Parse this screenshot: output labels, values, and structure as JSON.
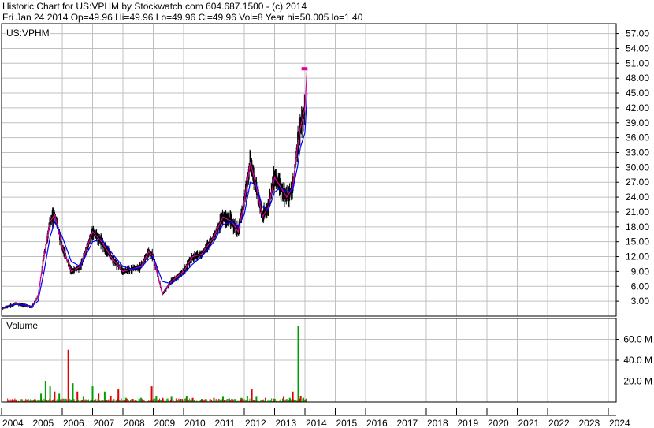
{
  "header": {
    "line1": "Historic Chart for US:VPHM by Stockwatch.com 604.687.1500 - (c) 2014",
    "line2": "Fri Jan 24 2014   Op=49.96  Hi=49.96  Lo=49.96  Cl=49.96  Vol=8   Year hi=50.005  lo=1.40"
  },
  "colors": {
    "grid": "#c0c0c0",
    "price_bar": "#000000",
    "ma_short": "#e000a0",
    "ma_long": "#0000ff",
    "volume_up": "#00a000",
    "volume_down": "#e00000"
  },
  "chart_data": [
    {
      "type": "line",
      "title": "US:VPHM",
      "ylim": [
        0,
        59
      ],
      "y_ticks": [
        "57.00",
        "54.00",
        "51.00",
        "48.00",
        "45.00",
        "42.00",
        "39.00",
        "36.00",
        "33.00",
        "30.00",
        "27.00",
        "24.00",
        "21.00",
        "18.00",
        "15.00",
        "12.00",
        "9.00",
        "6.00",
        "3.00"
      ],
      "grid": true,
      "x": [
        2004.0,
        2004.5,
        2005.0,
        2005.2,
        2005.4,
        2005.6,
        2005.75,
        2006.0,
        2006.3,
        2006.6,
        2007.0,
        2007.3,
        2007.6,
        2008.0,
        2008.3,
        2008.6,
        2008.85,
        2009.0,
        2009.3,
        2009.6,
        2010.0,
        2010.3,
        2010.6,
        2011.0,
        2011.3,
        2011.6,
        2011.8,
        2012.0,
        2012.2,
        2012.4,
        2012.6,
        2012.8,
        2013.0,
        2013.2,
        2013.4,
        2013.6,
        2013.75,
        2013.85,
        2014.0,
        2014.07
      ],
      "series": [
        {
          "values": [
            1.5,
            2.5,
            1.8,
            4.0,
            12.0,
            19.0,
            20.5,
            14.0,
            9.0,
            10.0,
            17.0,
            15.0,
            12.0,
            9.0,
            9.5,
            10.0,
            13.0,
            12.0,
            4.5,
            7.0,
            9.0,
            12.0,
            12.5,
            16.0,
            20.0,
            19.0,
            17.0,
            23.0,
            31.0,
            26.0,
            20.0,
            22.0,
            28.0,
            26.0,
            24.0,
            26.0,
            34.0,
            38.0,
            42.0,
            50.0
          ]
        },
        {
          "values": [
            1.6,
            2.4,
            2.0,
            3.0,
            9.0,
            16.0,
            19.0,
            16.0,
            11.0,
            10.0,
            15.0,
            15.5,
            13.0,
            10.0,
            9.5,
            9.8,
            11.5,
            12.0,
            7.0,
            6.5,
            8.5,
            10.5,
            12.0,
            15.0,
            18.5,
            19.0,
            18.0,
            20.5,
            27.0,
            26.5,
            22.0,
            21.5,
            25.0,
            26.0,
            25.0,
            25.5,
            30.0,
            34.0,
            37.0,
            45.0
          ]
        }
      ],
      "legend": "none"
    },
    {
      "type": "bar",
      "title": "Volume",
      "ylim": [
        0,
        80
      ],
      "y_ticks": [
        "60.0 M",
        "40.0 M",
        "20.0 M"
      ],
      "grid": true,
      "x_ticks": [
        "2004",
        "2005",
        "2006",
        "2007",
        "2008",
        "2009",
        "2010",
        "2011",
        "2012",
        "2013",
        "2014",
        "2015",
        "2016",
        "2017",
        "2018",
        "2019",
        "2020",
        "2021",
        "2022",
        "2023",
        "2024"
      ],
      "bars": [
        {
          "x": 2004.5,
          "value": 1,
          "dir": "up"
        },
        {
          "x": 2005.1,
          "value": 3,
          "dir": "down"
        },
        {
          "x": 2005.3,
          "value": 8,
          "dir": "up"
        },
        {
          "x": 2005.45,
          "value": 20,
          "dir": "up"
        },
        {
          "x": 2005.6,
          "value": 15,
          "dir": "up"
        },
        {
          "x": 2005.75,
          "value": 10,
          "dir": "down"
        },
        {
          "x": 2005.9,
          "value": 8,
          "dir": "up"
        },
        {
          "x": 2006.2,
          "value": 50,
          "dir": "down"
        },
        {
          "x": 2006.35,
          "value": 18,
          "dir": "up"
        },
        {
          "x": 2006.5,
          "value": 10,
          "dir": "down"
        },
        {
          "x": 2006.7,
          "value": 5,
          "dir": "up"
        },
        {
          "x": 2007.0,
          "value": 15,
          "dir": "up"
        },
        {
          "x": 2007.2,
          "value": 8,
          "dir": "down"
        },
        {
          "x": 2007.4,
          "value": 10,
          "dir": "up"
        },
        {
          "x": 2007.6,
          "value": 6,
          "dir": "down"
        },
        {
          "x": 2007.85,
          "value": 12,
          "dir": "down"
        },
        {
          "x": 2008.1,
          "value": 4,
          "dir": "up"
        },
        {
          "x": 2008.3,
          "value": 3,
          "dir": "down"
        },
        {
          "x": 2008.6,
          "value": 4,
          "dir": "up"
        },
        {
          "x": 2008.95,
          "value": 15,
          "dir": "down"
        },
        {
          "x": 2009.1,
          "value": 6,
          "dir": "up"
        },
        {
          "x": 2009.3,
          "value": 4,
          "dir": "down"
        },
        {
          "x": 2009.6,
          "value": 5,
          "dir": "up"
        },
        {
          "x": 2009.9,
          "value": 3,
          "dir": "down"
        },
        {
          "x": 2010.1,
          "value": 6,
          "dir": "up"
        },
        {
          "x": 2010.3,
          "value": 4,
          "dir": "down"
        },
        {
          "x": 2010.6,
          "value": 3,
          "dir": "up"
        },
        {
          "x": 2011.0,
          "value": 4,
          "dir": "down"
        },
        {
          "x": 2011.3,
          "value": 5,
          "dir": "up"
        },
        {
          "x": 2011.6,
          "value": 3,
          "dir": "down"
        },
        {
          "x": 2011.9,
          "value": 4,
          "dir": "up"
        },
        {
          "x": 2012.1,
          "value": 6,
          "dir": "up"
        },
        {
          "x": 2012.25,
          "value": 12,
          "dir": "down"
        },
        {
          "x": 2012.4,
          "value": 5,
          "dir": "up"
        },
        {
          "x": 2012.7,
          "value": 4,
          "dir": "down"
        },
        {
          "x": 2013.0,
          "value": 3,
          "dir": "up"
        },
        {
          "x": 2013.3,
          "value": 5,
          "dir": "down"
        },
        {
          "x": 2013.5,
          "value": 4,
          "dir": "up"
        },
        {
          "x": 2013.6,
          "value": 10,
          "dir": "down"
        },
        {
          "x": 2013.78,
          "value": 73,
          "dir": "up"
        },
        {
          "x": 2013.86,
          "value": 6,
          "dir": "down"
        },
        {
          "x": 2013.95,
          "value": 4,
          "dir": "up"
        }
      ]
    }
  ]
}
